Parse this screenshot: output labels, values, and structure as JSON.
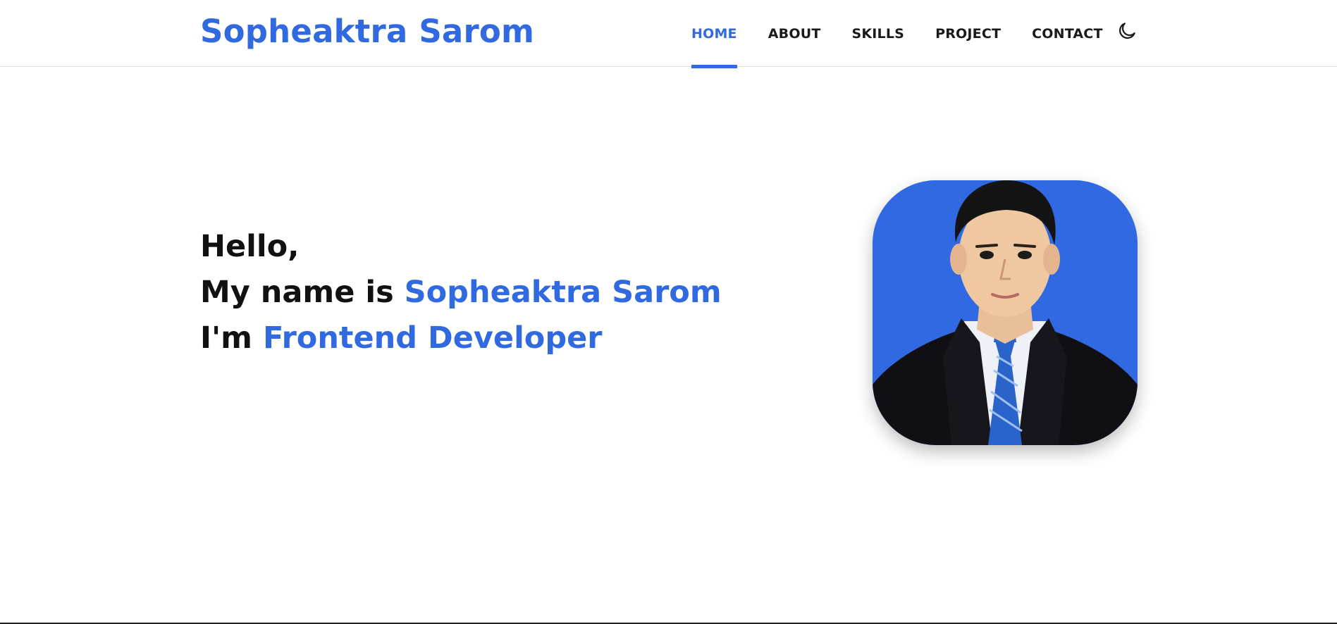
{
  "header": {
    "brand": "Sopheaktra Sarom",
    "nav": [
      {
        "label": "HOME",
        "active": true
      },
      {
        "label": "ABOUT",
        "active": false
      },
      {
        "label": "SKILLS",
        "active": false
      },
      {
        "label": "PROJECT",
        "active": false
      },
      {
        "label": "CONTACT",
        "active": false
      }
    ],
    "theme_toggle_icon": "moon-icon"
  },
  "hero": {
    "greeting": "Hello,",
    "name_prefix": "My name is ",
    "name": "Sopheaktra Sarom",
    "role_prefix": "I'm ",
    "role": "Frontend Developer"
  },
  "avatar": {
    "icon": "profile-photo"
  },
  "colors": {
    "accent": "#3069e0",
    "text": "#111111",
    "photo_background": "#3169e2"
  }
}
